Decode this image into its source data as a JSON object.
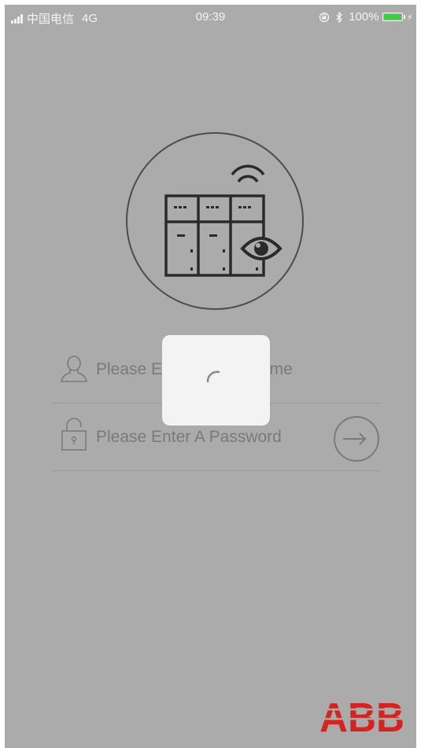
{
  "status_bar": {
    "carrier": "中国电信",
    "network": "4G",
    "time": "09:39",
    "battery_percent": "100%",
    "battery_level": 1.0,
    "icons": [
      "signal-bars-icon",
      "orientation-lock-icon",
      "bluetooth-icon",
      "battery-icon",
      "charging-icon"
    ]
  },
  "login": {
    "username_placeholder": "Please Enter A User Name",
    "password_placeholder": "Please Enter A Password",
    "icons": [
      "user-icon",
      "lock-icon",
      "login-arrow-icon"
    ]
  },
  "app_logo": {
    "icons": [
      "switchgear-cabinet-icon",
      "wifi-icon",
      "eye-icon"
    ]
  },
  "loading": {
    "icon": "spinner-icon"
  },
  "brand": {
    "text": "ABB",
    "color": "#d5241f"
  },
  "colors": {
    "background_overlay": "#ababab",
    "icon_dark": "#2a2a2a",
    "field_text": "#7a7a7a",
    "battery_green": "#42c94a"
  }
}
